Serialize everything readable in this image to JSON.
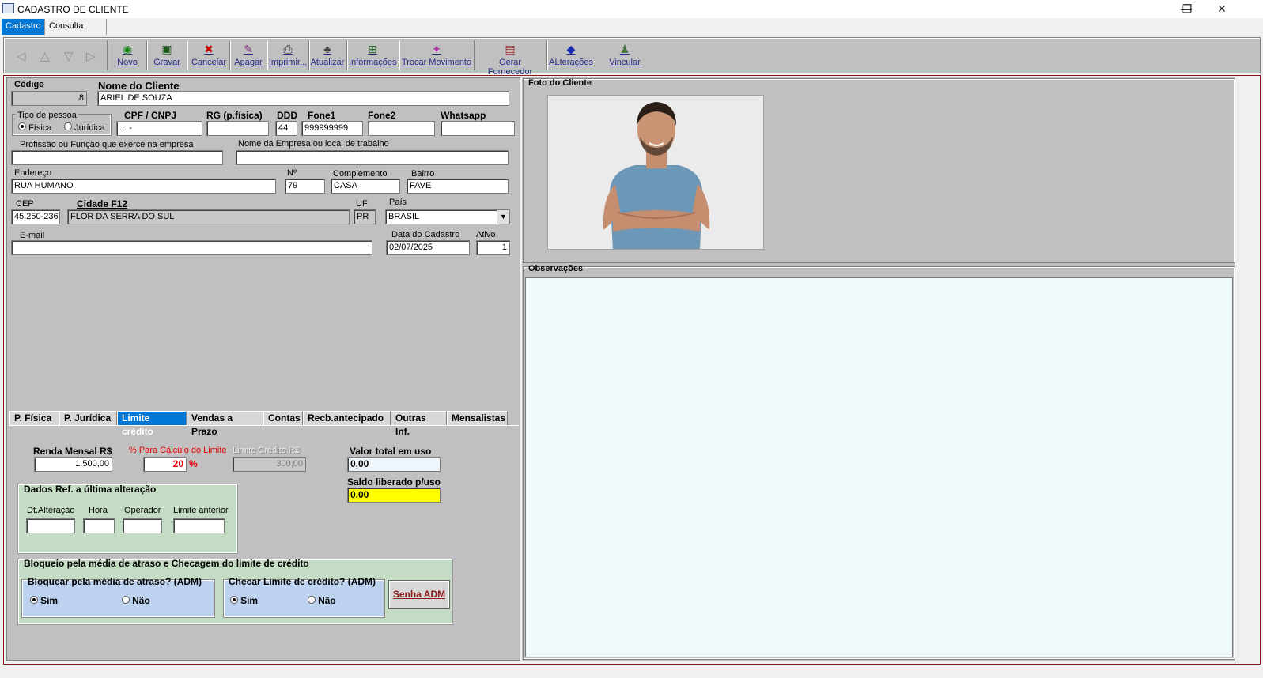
{
  "window": {
    "title": "CADASTRO DE CLIENTE",
    "min": "—",
    "restore": "❐",
    "close": "✕"
  },
  "top_tabs": [
    "Cadastro",
    "Consulta Geral"
  ],
  "toolbar": {
    "novo": "Novo",
    "gravar": "Gravar",
    "cancelar": "Cancelar",
    "apagar": "Apagar",
    "imprimir": "Imprimir...",
    "atualizar": "Atualizar",
    "informacoes": "Informações",
    "trocar": "Trocar Movimento",
    "gerar": "Gerar Fornecedor",
    "alteracoes": "ALterações",
    "vincular": "Vincular"
  },
  "form": {
    "codigo_label": "Código",
    "codigo": "8",
    "nome_label": "Nome do Cliente",
    "nome": "ARIEL DE SOUZA",
    "tipo_label": "Tipo de pessoa",
    "fisica": "Física",
    "juridica": "Jurídica",
    "cpf_label": "CPF / CNPJ",
    "cpf": " .  .  -",
    "rg_label": "RG (p.física)",
    "rg": "",
    "ddd_label": "DDD",
    "ddd": "44",
    "fone1_label": "Fone1",
    "fone1": "999999999",
    "fone2_label": "Fone2",
    "fone2": "",
    "whatsapp_label": "Whatsapp",
    "whatsapp": "",
    "profissao_label": "Profissão ou Função que exerce na empresa",
    "profissao": "",
    "empresa_label": "Nome da Empresa ou local de trabalho",
    "empresa": "",
    "endereco_label": "Endereço",
    "endereco": "RUA HUMANO",
    "numero_label": "Nº",
    "numero": "79",
    "complemento_label": "Complemento",
    "complemento": "CASA",
    "bairro_label": "Bairro",
    "bairro": "FAVE",
    "cep_label": "CEP",
    "cep": "45.250-236",
    "cidade_label": "Cidade F12",
    "cidade": "FLOR DA SERRA DO SUL",
    "uf_label": "UF",
    "uf": "PR",
    "pais_label": "País",
    "pais": "BRASIL",
    "email_label": "E-mail",
    "email": "",
    "data_label": "Data do Cadastro",
    "data": "02/07/2025",
    "ativo_label": "Ativo",
    "ativo": "1"
  },
  "bottom_tabs": [
    "P. Física",
    "P. Jurídica",
    "Limite crédito",
    "Vendas a Prazo",
    "Contas",
    "Recb.antecipado",
    "Outras Inf.",
    "Mensalistas"
  ],
  "limite": {
    "renda_label": "Renda Mensal R$",
    "renda": "1.500,00",
    "perc_label": "% Para Cálculo do Limite",
    "perc": "20",
    "perc_sym": "%",
    "limite_label": "Limite Crédito R$",
    "limite": "300,00",
    "uso_label": "Valor total em uso",
    "uso": "0,00",
    "saldo_label": "Saldo liberado p/uso",
    "saldo": "0,00",
    "dados_title": "Dados Ref. a última alteração",
    "dt_label": "Dt.Alteração",
    "hora_label": "Hora",
    "operador_label": "Operador",
    "anterior_label": "Limite anterior",
    "bloqueio_title": "Bloqueio pela média de atraso e Checagem do limite de crédito",
    "bloquear_label": "Bloquear pela média de atraso? (ADM)",
    "checar_label": "Checar Limite de crédito? (ADM)",
    "sim": "Sim",
    "nao": "Não",
    "senha_btn": "Senha ADM"
  },
  "foto_label": "Foto do Cliente",
  "obs_label": "Observações",
  "colors": {
    "accent": "#0078d7",
    "saldo_bg": "#ffff00",
    "obs_bg": "#f0fafc",
    "green_box": "#c3dcc3",
    "blue_box": "#bcd2ee"
  }
}
